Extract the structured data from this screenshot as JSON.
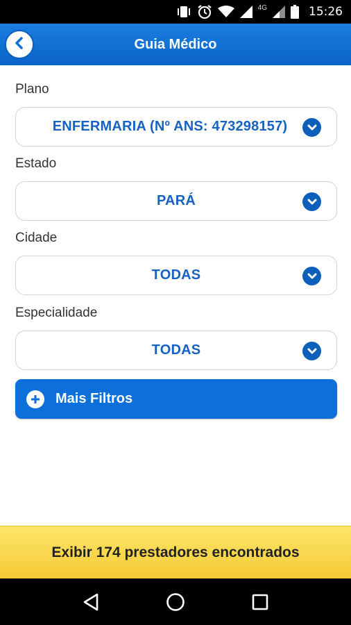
{
  "status_bar": {
    "time": "15:26",
    "network": "4G",
    "icons": [
      "vibrate-icon",
      "alarm-icon",
      "wifi-icon",
      "signal-icon",
      "signal-icon",
      "battery-icon"
    ]
  },
  "app_bar": {
    "title": "Guia Médico",
    "back_icon": "chevron-left-icon"
  },
  "form": {
    "plano": {
      "label": "Plano",
      "value": "ENFERMARIA (Nº ANS: 473298157)"
    },
    "estado": {
      "label": "Estado",
      "value": "PARÁ"
    },
    "cidade": {
      "label": "Cidade",
      "value": "TODAS"
    },
    "especialidade": {
      "label": "Especialidade",
      "value": "TODAS"
    }
  },
  "more_filters": {
    "label": "Mais Filtros",
    "icon": "plus-icon"
  },
  "cta": {
    "label": "Exibir 174 prestadores encontrados"
  },
  "nav_bar": {
    "icons": [
      "back-triangle-icon",
      "home-circle-icon",
      "recents-square-icon"
    ]
  },
  "colors": {
    "primary": "#0d6fd9",
    "primary_dark": "#0d5fb9",
    "select_text": "#1562c4",
    "cta_yellow": "#f9d84a"
  }
}
